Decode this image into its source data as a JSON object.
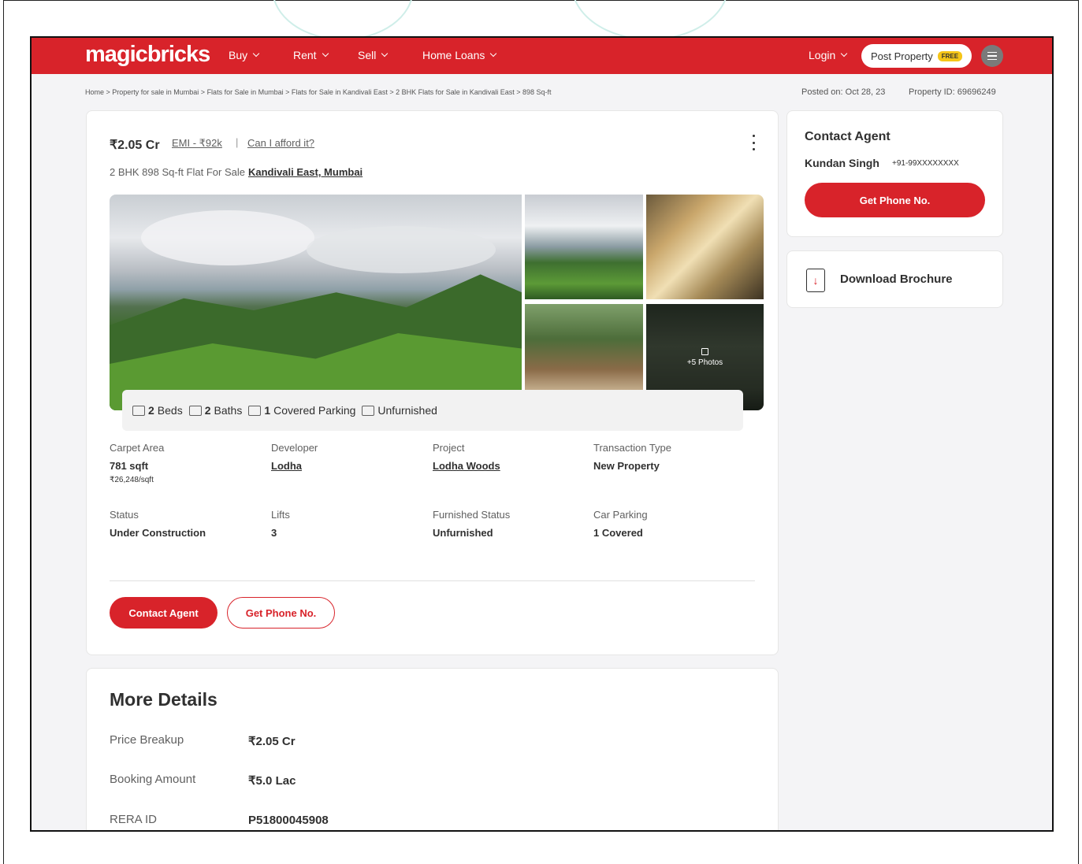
{
  "header": {
    "logo": "magicbricks",
    "nav": [
      {
        "label": "Buy"
      },
      {
        "label": "Rent"
      },
      {
        "label": "Sell"
      },
      {
        "label": "Home Loans"
      }
    ],
    "login": "Login",
    "post_property": "Post Property",
    "free_badge": "FREE"
  },
  "breadcrumb": "Home > Property for sale in Mumbai > Flats for Sale in Mumbai > Flats for Sale in Kandivali East > 2 BHK Flats for Sale in Kandivali East > 898 Sq-ft",
  "posted_on": "Posted on: Oct 28, 23",
  "property_id": "Property ID: 69696249",
  "listing": {
    "price": "₹2.05 Cr",
    "emi": "EMI - ₹92k",
    "separator": "|",
    "afford": "Can I afford it?",
    "subtitle": "2 BHK 898 Sq-ft Flat For Sale",
    "location": "Kandivali East, Mumbai",
    "more_photos": "+5 Photos",
    "features": [
      {
        "value": "2",
        "text": "Beds",
        "icon": "bed-icon"
      },
      {
        "value": "2",
        "text": "Baths",
        "icon": "bath-icon"
      },
      {
        "value": "1",
        "text": "Covered Parking",
        "icon": "car-icon"
      },
      {
        "value": "",
        "text": "Unfurnished",
        "icon": "furnish-icon"
      }
    ],
    "details": [
      {
        "label": "Carpet Area",
        "value": "781 sqft",
        "sub": "₹26,248/sqft"
      },
      {
        "label": "Developer",
        "value": "Lodha"
      },
      {
        "label": "Project",
        "value": "Lodha Woods"
      },
      {
        "label": "Transaction Type",
        "value": "New Property"
      },
      {
        "label": "Status",
        "value": "Under Construction"
      },
      {
        "label": "Lifts",
        "value": "3"
      },
      {
        "label": "Furnished Status",
        "value": "Unfurnished"
      },
      {
        "label": "Car Parking",
        "value": "1 Covered"
      }
    ],
    "contact_agent": "Contact Agent",
    "get_phone": "Get Phone No."
  },
  "more_details": {
    "title": "More Details",
    "rows": [
      {
        "label": "Price Breakup",
        "value": "₹2.05 Cr"
      },
      {
        "label": "Booking Amount",
        "value": "₹5.0 Lac"
      },
      {
        "label": "RERA ID",
        "value": "P51800045908"
      }
    ]
  },
  "agent_card": {
    "title": "Contact Agent",
    "name": "Kundan Singh",
    "phone": "+91-99XXXXXXXX",
    "button": "Get Phone No."
  },
  "brochure": {
    "label": "Download Brochure"
  },
  "colors": {
    "brand": "#d8232a",
    "text": "#303030",
    "muted": "#606060"
  }
}
